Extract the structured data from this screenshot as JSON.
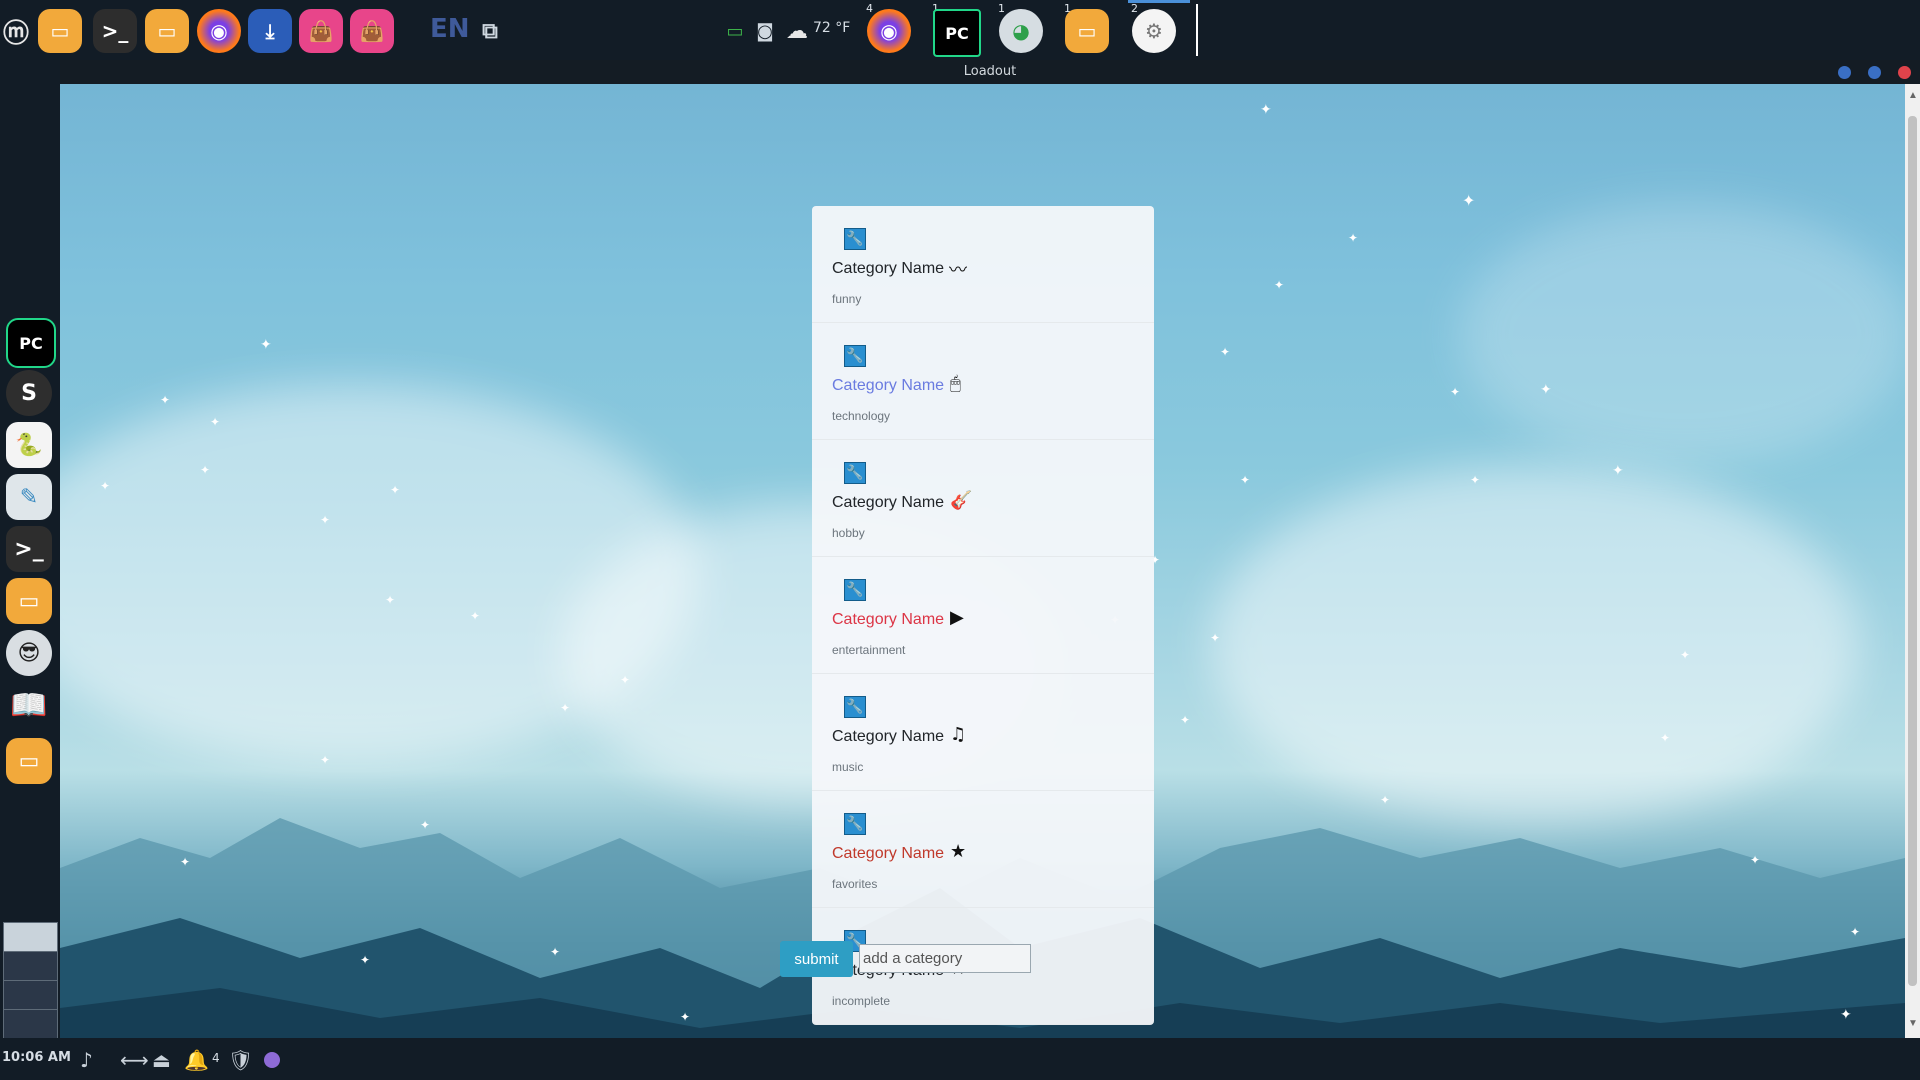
{
  "top_panel": {
    "language": "EN",
    "weather_temp": "72 °F",
    "task_badges": [
      "4",
      "1",
      "1",
      "1",
      "2"
    ]
  },
  "window": {
    "title": "Loadout"
  },
  "categories": [
    {
      "name": "Category Name",
      "tag": "funny",
      "icon": "mustache-icon",
      "glyph": "〰",
      "name_color": "#212529"
    },
    {
      "name": "Category Name",
      "tag": "technology",
      "icon": "mouse-icon",
      "glyph": "🖱",
      "name_color": "#6a7be0"
    },
    {
      "name": "Category Name",
      "tag": "hobby",
      "icon": "guitar-icon",
      "glyph": "🎸",
      "name_color": "#212529"
    },
    {
      "name": "Category Name",
      "tag": "entertainment",
      "icon": "video-icon",
      "glyph": "▶",
      "name_color": "#dc3545"
    },
    {
      "name": "Category Name",
      "tag": "music",
      "icon": "music-note-icon",
      "glyph": "♫",
      "name_color": "#212529"
    },
    {
      "name": "Category Name",
      "tag": "favorites",
      "icon": "star-icon",
      "glyph": "★",
      "name_color": "#c0392b"
    },
    {
      "name": "Category Name",
      "tag": "incomplete",
      "icon": "star-icon",
      "glyph": "★",
      "name_color": "#212529"
    }
  ],
  "form": {
    "submit_label": "submit",
    "input_placeholder": "add a category",
    "input_value": ""
  },
  "bottom_panel": {
    "clock": "10:06 AM",
    "notification_count": "4"
  },
  "colors": {
    "panel_bg": "#121c26",
    "accent": "#2e9ec4"
  }
}
